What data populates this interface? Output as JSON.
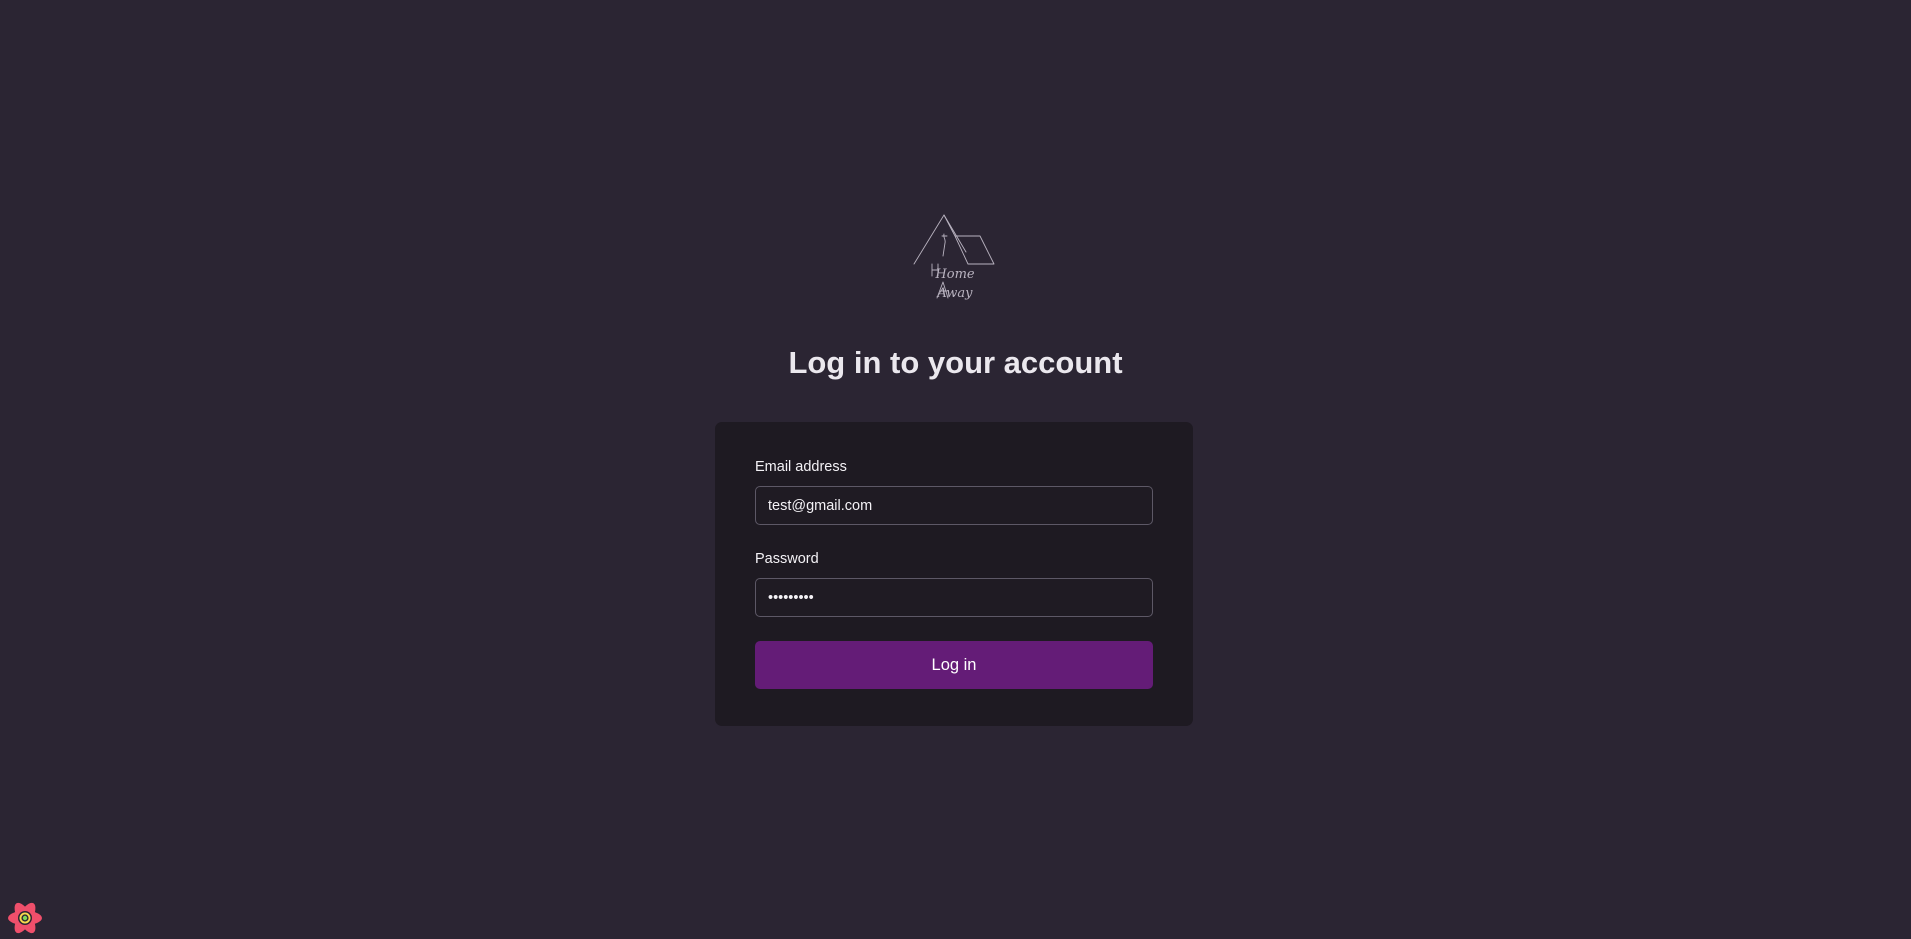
{
  "brand": {
    "logo_text_line1": "Home",
    "logo_text_line2": "Away"
  },
  "header": {
    "title": "Log in to your account"
  },
  "form": {
    "email": {
      "label": "Email address",
      "value": "test@gmail.com"
    },
    "password": {
      "label": "Password",
      "value": "testtest1"
    },
    "submit_label": "Log in"
  },
  "colors": {
    "background": "#2b2533",
    "card": "#1e1a22",
    "accent": "#641c77"
  },
  "icons": {
    "logo": "home-away-logo-icon",
    "devtools": "react-query-devtools-icon"
  }
}
